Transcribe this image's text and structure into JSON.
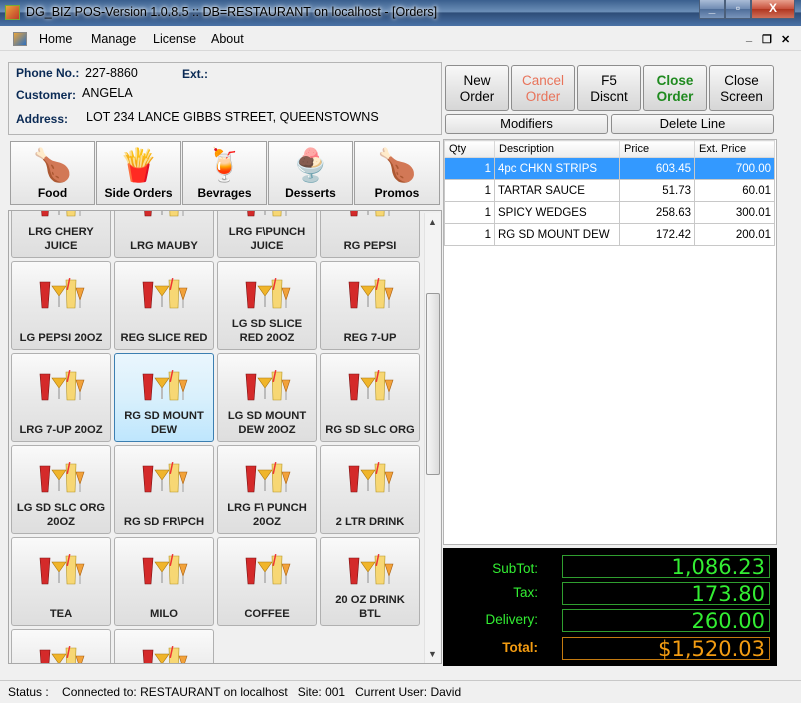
{
  "window": {
    "title": "DG_BIZ POS-Version 1.0.8.5 :: DB=RESTAURANT on localhost - [Orders]",
    "minimize": "_",
    "maximize": "▫",
    "close": "X"
  },
  "menu": {
    "items": [
      "Home",
      "Manage",
      "License",
      "About"
    ],
    "mdi_min": "_",
    "mdi_restore": "❐",
    "mdi_close": "✕"
  },
  "customer": {
    "phone_label": "Phone No.:",
    "phone": "227-8860",
    "ext_label": "Ext.:",
    "ext": "",
    "customer_label": "Customer:",
    "customer": "ANGELA",
    "address_label": "Address:",
    "address": "LOT 234 LANCE GIBBS STREET, QUEENSTOWNS"
  },
  "categories": [
    {
      "label": "Food",
      "icon": "🍗"
    },
    {
      "label": "Side Orders",
      "icon": "🍟"
    },
    {
      "label": "Bevrages",
      "icon": "🍹"
    },
    {
      "label": "Desserts",
      "icon": "🍨"
    },
    {
      "label": "Promos",
      "icon": "🍗"
    }
  ],
  "items": [
    "LRG CHERY JUICE",
    "LRG MAUBY",
    "LRG F\\PUNCH JUICE",
    "RG PEPSI",
    "LG PEPSI 20OZ",
    "REG SLICE RED",
    "LG SD SLICE RED 20OZ",
    "REG 7-UP",
    "LRG 7-UP 20OZ",
    "RG SD MOUNT DEW",
    "LG SD MOUNT DEW 20OZ",
    "RG SD SLC ORG",
    "LG SD SLC ORG 20OZ",
    "RG SD FR\\PCH",
    "LRG F\\ PUNCH 20OZ",
    "2 LTR DRINK",
    "TEA",
    "MILO",
    "COFFEE",
    "20 OZ DRINK BTL",
    "",
    ""
  ],
  "toolbar": {
    "new_order": [
      "New",
      "Order"
    ],
    "cancel_order": [
      "Cancel",
      "Order"
    ],
    "discount": [
      "F5",
      "Discnt"
    ],
    "close_order": [
      "Close",
      "Order"
    ],
    "close_screen": [
      "Close",
      "Screen"
    ],
    "modifiers": "Modifiers",
    "delete_line": "Delete Line"
  },
  "order": {
    "columns": [
      "Qty",
      "Description",
      "Price",
      "Ext. Price"
    ],
    "rows": [
      {
        "qty": "1",
        "desc": "4pc CHKN STRIPS",
        "price": "603.45",
        "ext": "700.00"
      },
      {
        "qty": "1",
        "desc": "TARTAR SAUCE",
        "price": "51.73",
        "ext": "60.01"
      },
      {
        "qty": "1",
        "desc": "SPICY WEDGES",
        "price": "258.63",
        "ext": "300.01"
      },
      {
        "qty": "1",
        "desc": "RG SD MOUNT DEW",
        "price": "172.42",
        "ext": "200.01"
      }
    ]
  },
  "totals": {
    "subtotal_label": "SubTot:",
    "subtotal": "1,086.23",
    "tax_label": "Tax:",
    "tax": "173.80",
    "delivery_label": "Delivery:",
    "delivery": "260.00",
    "total_label": "Total:",
    "total": "$1,520.03"
  },
  "status": {
    "label": "Status :",
    "connection": "Connected to: RESTAURANT on localhost",
    "site": "Site: 001",
    "user": "Current User: David"
  },
  "colors": {
    "selected_row": "#3399ff",
    "totals_green": "#33ee33",
    "total_orange": "#f39c12",
    "cancel_red": "#e8735a",
    "close_order_green": "#1f8a1f"
  }
}
